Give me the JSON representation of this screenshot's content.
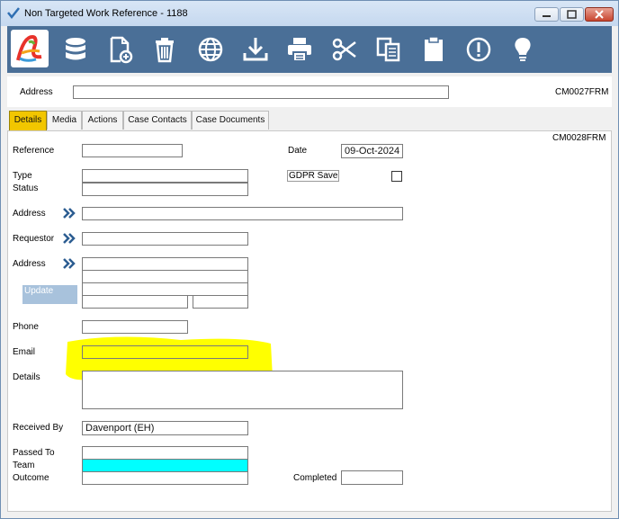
{
  "window": {
    "title": "Non Targeted Work Reference - 1188"
  },
  "toolbar": {
    "icons": [
      "app-logo-icon",
      "database-icon",
      "new-document-icon",
      "trash-icon",
      "globe-icon",
      "download-icon",
      "print-icon",
      "scissors-icon",
      "copy-icon",
      "clipboard-icon",
      "alert-icon",
      "lightbulb-icon"
    ]
  },
  "header": {
    "address_label": "Address",
    "address_value": "",
    "form_code": "CM0027FRM"
  },
  "tabs": [
    {
      "label": "Details",
      "active": true
    },
    {
      "label": "Media",
      "active": false
    },
    {
      "label": "Actions",
      "active": false
    },
    {
      "label": "Case Contacts",
      "active": false
    },
    {
      "label": "Case Documents",
      "active": false
    }
  ],
  "form": {
    "form_code": "CM0028FRM",
    "reference_label": "Reference",
    "reference_value": "",
    "date_label": "Date",
    "date_value": "09-Oct-2024",
    "type_label": "Type",
    "type_value": "",
    "status_label": "Status",
    "status_value": "",
    "gdpr_label": "GDPR Save",
    "gdpr_checked": false,
    "address_label": "Address",
    "address_value": "",
    "requestor_label": "Requestor",
    "requestor_value": "",
    "req_address_label": "Address",
    "req_address_lines": [
      "",
      "",
      "",
      "",
      ""
    ],
    "update_label": "Update",
    "phone_label": "Phone",
    "phone_value": "",
    "email_label": "Email",
    "email_value": "",
    "details_label": "Details",
    "details_value": "",
    "received_by_label": "Received By",
    "received_by_value": "Davenport (EH)",
    "passed_to_label": "Passed To",
    "passed_to_value": "",
    "team_label": "Team",
    "team_value": "",
    "outcome_label": "Outcome",
    "outcome_value": "",
    "completed_label": "Completed",
    "completed_value": ""
  },
  "colors": {
    "toolbar": "#4a6f97",
    "active_tab": "#f2c600",
    "team_fill": "#00ffff",
    "highlight": "#ffff00",
    "update_button": "#a8c2dc"
  }
}
